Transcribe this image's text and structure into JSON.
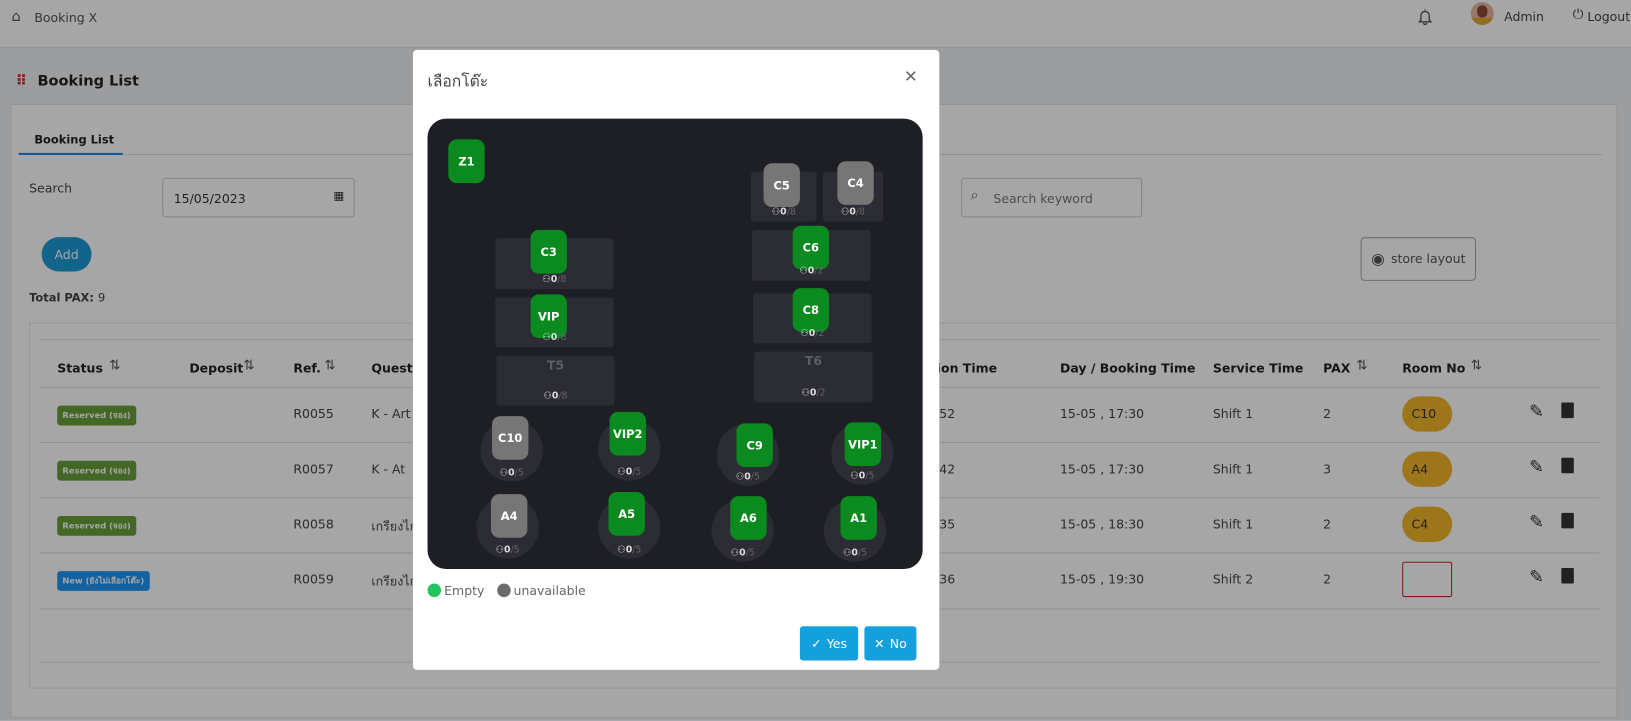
{
  "nav": {
    "brand": "Booking X",
    "user": "Admin",
    "logout": "Logout"
  },
  "page": {
    "title": "Booking List",
    "tab": "Booking List",
    "search_label": "Search",
    "date_value": "15/05/2023",
    "keyword_placeholder": "Search keyword",
    "add_label": "Add",
    "store_layout_label": "store layout",
    "total_pax_label": "Total PAX:",
    "total_pax_value": "9"
  },
  "table": {
    "headers": [
      "Status",
      "Deposit",
      "Ref.",
      "Quest name",
      "Transaction Time",
      "Day / Booking Time",
      "Service Time",
      "PAX",
      "Room No"
    ],
    "rows": [
      {
        "status": "Reserved (จอง)",
        "status_color": "#689f38",
        "deposit": "",
        "ref": "R0055",
        "guest": "K - Art",
        "transaction": "52",
        "booking": "15-05 , 17:30",
        "service": "Shift 1",
        "pax": "2",
        "room": "C10"
      },
      {
        "status": "Reserved (จอง)",
        "status_color": "#689f38",
        "deposit": "",
        "ref": "R0057",
        "guest": "K - At",
        "transaction": "42",
        "booking": "15-05 , 17:30",
        "service": "Shift 1",
        "pax": "3",
        "room": "A4"
      },
      {
        "status": "Reserved (จอง)",
        "status_color": "#689f38",
        "deposit": "",
        "ref": "R0058",
        "guest": "เกรียงไก",
        "transaction": "35",
        "booking": "15-05 , 18:30",
        "service": "Shift 1",
        "pax": "2",
        "room": "C4"
      },
      {
        "status": "New (ยังไม่เลือกโต๊ะ)",
        "status_color": "#2196f3",
        "deposit": "",
        "ref": "R0059",
        "guest": "เกรียงไก",
        "transaction": "36",
        "booking": "15-05 , 19:30",
        "service": "Shift 2",
        "pax": "2",
        "room": ""
      }
    ]
  },
  "modal": {
    "title": "เลือกโต๊ะ",
    "legend": [
      {
        "label": "Empty",
        "color": "#22c55e"
      },
      {
        "label": "unavailable",
        "color": "#6b6b6b"
      }
    ],
    "yes_label": "Yes",
    "no_label": "No",
    "colors": {
      "empty": "#0b8a1f",
      "unavailable": "#767676"
    },
    "tables": [
      {
        "name": "Z1",
        "status": "empty",
        "shape": "none"
      },
      {
        "name": "C5",
        "status": "unavailable",
        "shape": "rect",
        "guests": "0",
        "capacity": "/8"
      },
      {
        "name": "C4",
        "status": "unavailable",
        "shape": "rect",
        "guests": "0",
        "capacity": "/8"
      },
      {
        "name": "C3",
        "status": "empty",
        "shape": "rect",
        "guests": "0",
        "capacity": "/8"
      },
      {
        "name": "VIP",
        "status": "empty",
        "shape": "rect",
        "guests": "0",
        "capacity": "/8"
      },
      {
        "name": "T5",
        "status": "label",
        "shape": "rect",
        "guests": "0",
        "capacity": "/8"
      },
      {
        "name": "C6",
        "status": "empty",
        "shape": "rect",
        "guests": "0",
        "capacity": "/2"
      },
      {
        "name": "C8",
        "status": "empty",
        "shape": "rect",
        "guests": "0",
        "capacity": "/2"
      },
      {
        "name": "T6",
        "status": "label",
        "shape": "rect",
        "guests": "0",
        "capacity": "/2"
      },
      {
        "name": "C10",
        "status": "unavailable",
        "shape": "round",
        "guests": "0",
        "capacity": "/5"
      },
      {
        "name": "VIP2",
        "status": "empty",
        "shape": "round",
        "guests": "0",
        "capacity": "/5"
      },
      {
        "name": "C9",
        "status": "empty",
        "shape": "round",
        "guests": "0",
        "capacity": "/5"
      },
      {
        "name": "VIP1",
        "status": "empty",
        "shape": "round",
        "guests": "0",
        "capacity": "/5"
      },
      {
        "name": "A4",
        "status": "unavailable",
        "shape": "round",
        "guests": "0",
        "capacity": "/5"
      },
      {
        "name": "A5",
        "status": "empty",
        "shape": "round",
        "guests": "0",
        "capacity": "/5"
      },
      {
        "name": "A6",
        "status": "empty",
        "shape": "round",
        "guests": "0",
        "capacity": "/5"
      },
      {
        "name": "A1",
        "status": "empty",
        "shape": "round",
        "guests": "0",
        "capacity": "/5"
      }
    ]
  }
}
